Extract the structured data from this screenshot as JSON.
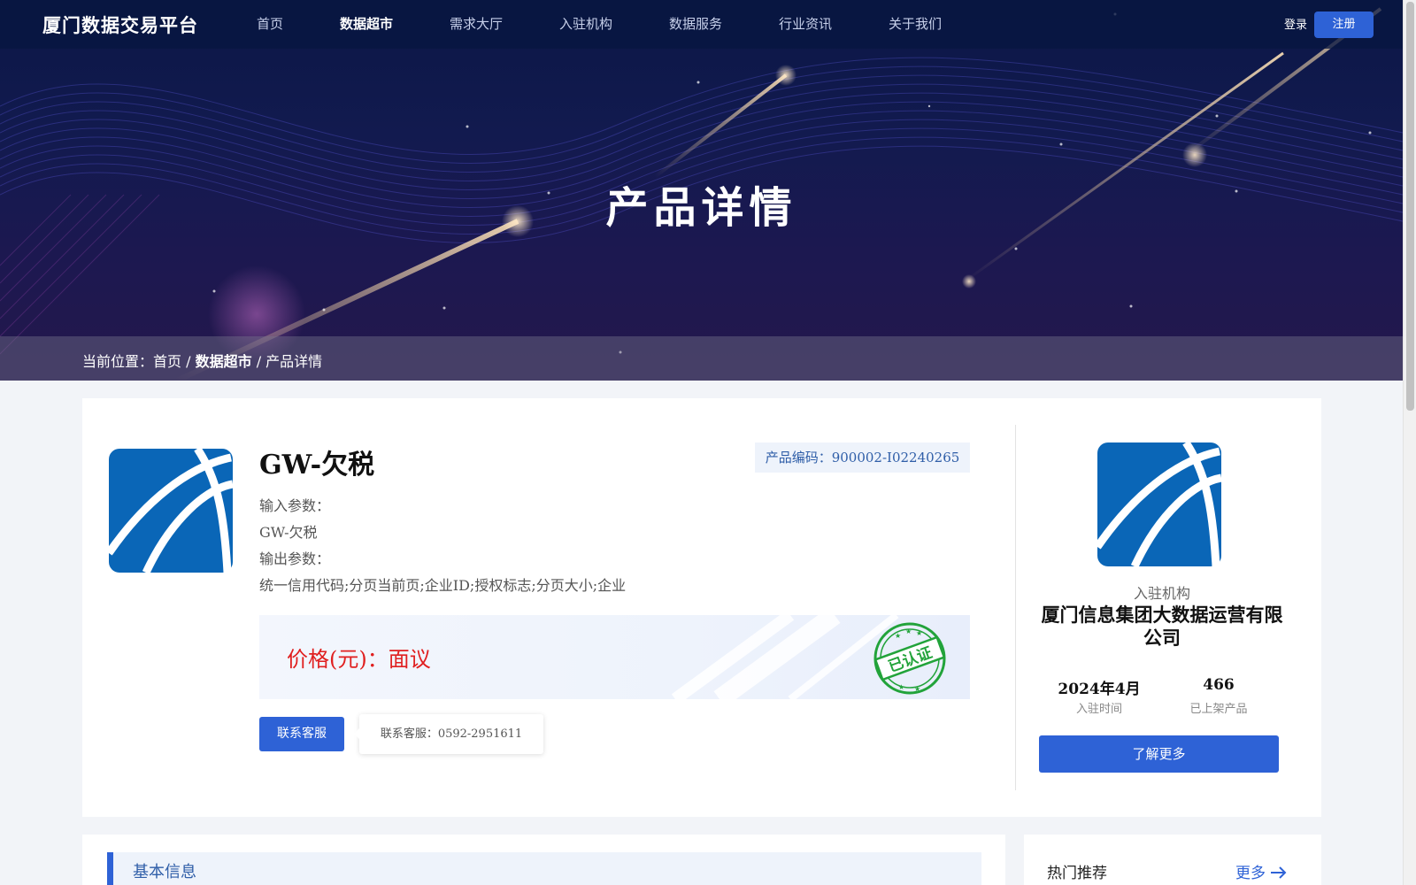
{
  "nav": {
    "logo": "厦门数据交易平台",
    "items": [
      "首页",
      "数据超市",
      "需求大厅",
      "入驻机构",
      "数据服务",
      "行业资讯",
      "关于我们"
    ],
    "login": "登录",
    "register": "注册"
  },
  "hero": {
    "title": "产品详情"
  },
  "breadcrumb": {
    "prefix": "当前位置：",
    "home": "首页",
    "sep1": " / ",
    "section": "数据超市",
    "sep2": " / ",
    "current": "产品详情"
  },
  "product": {
    "name": "GW-欠税",
    "code": "产品编码：900002-I02240265",
    "input_label": "输入参数：",
    "input_value": "GW-欠税",
    "output_label": "输出参数：",
    "output_value": "统一信用代码;分页当前页;企业ID;授权标志;分页大小;企业",
    "price": "价格(元)：面议",
    "stamp_text": "已认证",
    "service_button": "联系客服",
    "service_tip": "联系客服：0592-2951611"
  },
  "org": {
    "type": "入驻机构",
    "name": "厦门信息集团大数据运营有限公司",
    "join_date": "2024年4月",
    "join_label": "入驻时间",
    "products": "466",
    "products_label": "已上架产品",
    "more_button": "了解更多"
  },
  "sections": {
    "basic_info": "基本信息",
    "hot": "热门推荐",
    "more": "更多"
  },
  "colors": {
    "primary": "#2e62d6",
    "price": "#e02020",
    "stamp": "#22a33a",
    "logo_blue": "#0a66b7"
  }
}
